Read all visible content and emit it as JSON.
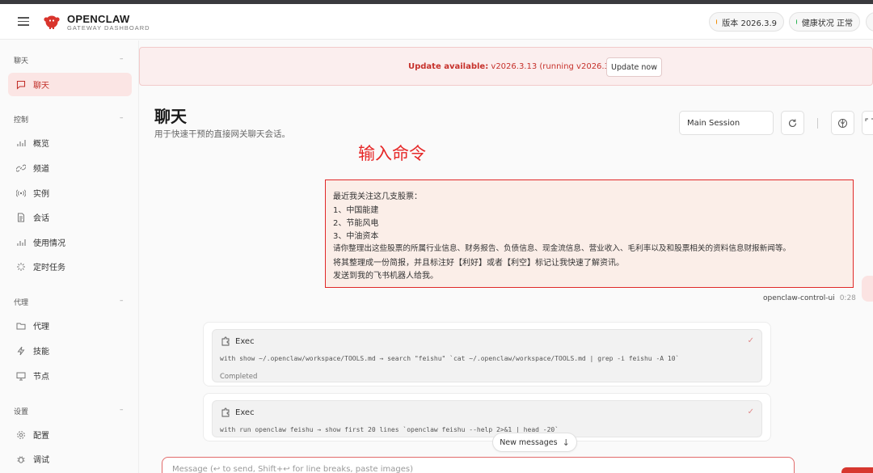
{
  "header": {
    "brand_name": "OPENCLAW",
    "brand_subtitle": "GATEWAY DASHBOARD",
    "version_pill": "版本 2026.3.9",
    "version_dot_color": "#f08c00",
    "health_pill": "健康状况 正常",
    "health_dot_color": "#22b14c"
  },
  "sidebar": {
    "sections": [
      {
        "title": "聊天",
        "collapse": "–"
      },
      {
        "title": "控制",
        "collapse": "–"
      },
      {
        "title": "代理",
        "collapse": "–"
      },
      {
        "title": "设置",
        "collapse": "–"
      }
    ],
    "items": [
      {
        "label": "聊天",
        "icon": "chat-icon",
        "active": true
      },
      {
        "label": "概览",
        "icon": "bar-chart-icon"
      },
      {
        "label": "频道",
        "icon": "link-icon"
      },
      {
        "label": "实例",
        "icon": "broadcast-icon"
      },
      {
        "label": "会话",
        "icon": "document-icon"
      },
      {
        "label": "使用情况",
        "icon": "bar-chart-icon"
      },
      {
        "label": "定时任务",
        "icon": "spark-icon"
      },
      {
        "label": "代理",
        "icon": "folder-icon"
      },
      {
        "label": "技能",
        "icon": "bolt-icon"
      },
      {
        "label": "节点",
        "icon": "monitor-icon"
      },
      {
        "label": "配置",
        "icon": "gear-icon"
      },
      {
        "label": "调试",
        "icon": "bug-icon"
      }
    ]
  },
  "update_banner": {
    "label": "Update available:",
    "text": " v2026.3.13 (running v2026.3.9).",
    "button": "Update now"
  },
  "main": {
    "title": "聊天",
    "subtitle": "用于快速干预的直接网关聊天会话。",
    "session_select": "Main Session",
    "annotation": "输入命令",
    "accent_color": "#d7372f"
  },
  "user_message": {
    "lines": [
      "最近我关注这几支股票：",
      "1、中国能建",
      "2、节能风电",
      "3、中油资本",
      "请你整理出这些股票的所属行业信息、财务报告、负债信息、现金流信息、营业收入、毛利率以及和股票相关的资料信息财报新闻等。",
      "将其整理成一份简报，并且标注好【利好】或者【利空】标记让我快速了解资讯。",
      "发送到我的飞书机器人给我。"
    ],
    "sender": "openclaw-control-ui",
    "time": "0:28"
  },
  "tool_calls": [
    {
      "name": "Exec",
      "command": "with show ~/.openclaw/workspace/TOOLS.md → search \"feishu\" `cat ~/.openclaw/workspace/TOOLS.md | grep -i feishu -A 10`",
      "status": "Completed"
    },
    {
      "name": "Exec",
      "command": "with run openclaw feishu → show first 20 lines `openclaw feishu --help 2>&1 | head -20`",
      "status": ""
    }
  ],
  "new_messages_button": "New messages",
  "composer": {
    "placeholder": "Message (↩ to send, Shift+↩ for line breaks, paste images)"
  }
}
